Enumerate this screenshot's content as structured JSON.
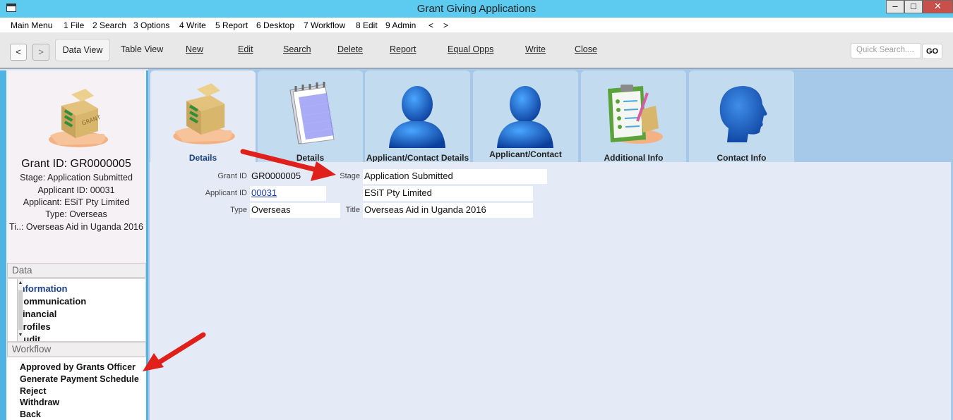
{
  "window": {
    "title": "Grant Giving Applications",
    "min_symbol": "–",
    "max_symbol": "□",
    "close_symbol": "✕"
  },
  "menu": {
    "items": [
      "Main Menu",
      "1 File",
      "2 Search",
      "3 Options",
      "4 Write",
      "5 Report",
      "6 Desktop",
      "7 Workflow",
      "8 Edit",
      "9 Admin",
      "<",
      ">"
    ]
  },
  "toolbar": {
    "back": "<",
    "forward": ">",
    "data_view": "Data View",
    "table_view": "Table View",
    "new": "New",
    "edit": "Edit",
    "search": "Search",
    "delete": "Delete",
    "report": "Report",
    "equal_opps": "Equal Opps",
    "write": "Write",
    "close": "Close",
    "quick_search_placeholder": "Quick Search....",
    "go": "GO"
  },
  "summary": {
    "grant_id": "Grant ID: GR0000005",
    "stage": "Stage: Application Submitted",
    "applicant_id": "Applicant ID: 00031",
    "applicant": "Applicant: ESiT Pty Limited",
    "type": "Type: Overseas",
    "title": "Ti..: Overseas Aid in Uganda 2016"
  },
  "data_section": {
    "header": "Data",
    "items": [
      "Information",
      "Communication",
      "Financial",
      "Profiles",
      "Audit"
    ]
  },
  "workflow_section": {
    "header": "Workflow",
    "items": [
      "Approved by Grants Officer",
      "Generate Payment Schedule",
      "Reject",
      "Withdraw",
      "Back"
    ]
  },
  "tabs": [
    {
      "label": "Details",
      "icon": "grant-box-icon"
    },
    {
      "label": "Details",
      "icon": "notepad-icon"
    },
    {
      "label": "Applicant/Contact Details",
      "icon": "person-icon"
    },
    {
      "label": "Applicant/Contact",
      "icon": "person-icon"
    },
    {
      "label": "Additional Info",
      "icon": "clipboard-icon"
    },
    {
      "label": "Contact Info",
      "icon": "head-profile-icon"
    }
  ],
  "form": {
    "grant_id_label": "Grant ID",
    "grant_id": "GR0000005",
    "stage_label": "Stage",
    "stage": "Application Submitted",
    "applicant_id_label": "Applicant ID",
    "applicant_id": "00031",
    "applicant_name": "ESiT Pty Limited",
    "type_label": "Type",
    "type": "Overseas",
    "title_label": "Title",
    "title": "Overseas Aid in Uganda 2016"
  },
  "colors": {
    "titlebar": "#5ccbef",
    "accent_red": "#e0201b",
    "active_tab_text": "#173e86"
  }
}
